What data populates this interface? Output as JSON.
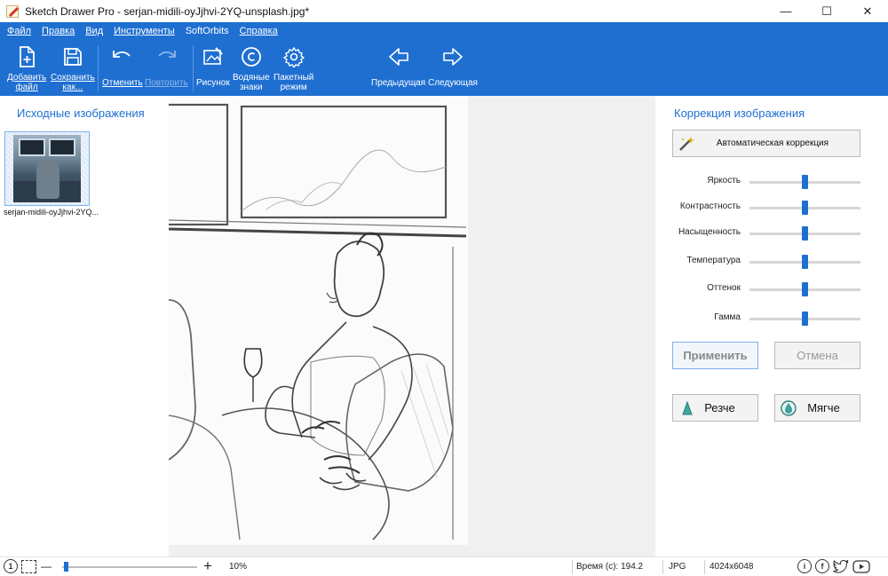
{
  "window": {
    "title": "Sketch Drawer Pro - serjan-midili-oyJjhvi-2YQ-unsplash.jpg*",
    "minimize_glyph": "—",
    "maximize_glyph": "☐",
    "close_glyph": "✕"
  },
  "menu": [
    "Файл",
    "Правка",
    "Вид",
    "Инструменты",
    "SoftOrbits",
    "Справка"
  ],
  "toolbar": {
    "add_file": [
      "Добавить",
      "файл"
    ],
    "save_as": [
      "Сохранить",
      "как..."
    ],
    "undo": "Отменить",
    "redo": "Повторить",
    "drawing": "Рисунок",
    "watermarks": [
      "Водяные",
      "знаки"
    ],
    "batch": [
      "Пакетный",
      "режим"
    ],
    "previous": "Предыдущая",
    "next": "Следующая"
  },
  "left_panel": {
    "title": "Исходные изображения",
    "thumbnail_label": "serjan-midili-oyJjhvi-2YQ..."
  },
  "right_panel": {
    "title": "Коррекция изображения",
    "auto_correction": "Автоматическая коррекция",
    "sliders": [
      {
        "label": "Яркость",
        "value": 0.5
      },
      {
        "label": "Контрастность",
        "value": 0.5
      },
      {
        "label": "Насыщенность",
        "value": 0.5
      },
      {
        "label": "Температура",
        "value": 0.5
      },
      {
        "label": "Оттенок",
        "value": 0.5
      },
      {
        "label": "Гамма",
        "value": 0.5
      }
    ],
    "apply": "Применить",
    "cancel": "Отмена",
    "sharper": "Резче",
    "softer": "Мягче"
  },
  "statusbar": {
    "zoom": "10%",
    "zoom_level": 0.01,
    "time": "Время (с): 194.2",
    "format": "JPG",
    "dimensions": "4024x6048",
    "minus_glyph": "—",
    "plus_glyph": "+",
    "info_glyph": "i"
  },
  "colors": {
    "accent": "#1f6fd1",
    "ribbon_bg": "#1f6fd1",
    "panel_title": "#1f6fd1"
  }
}
